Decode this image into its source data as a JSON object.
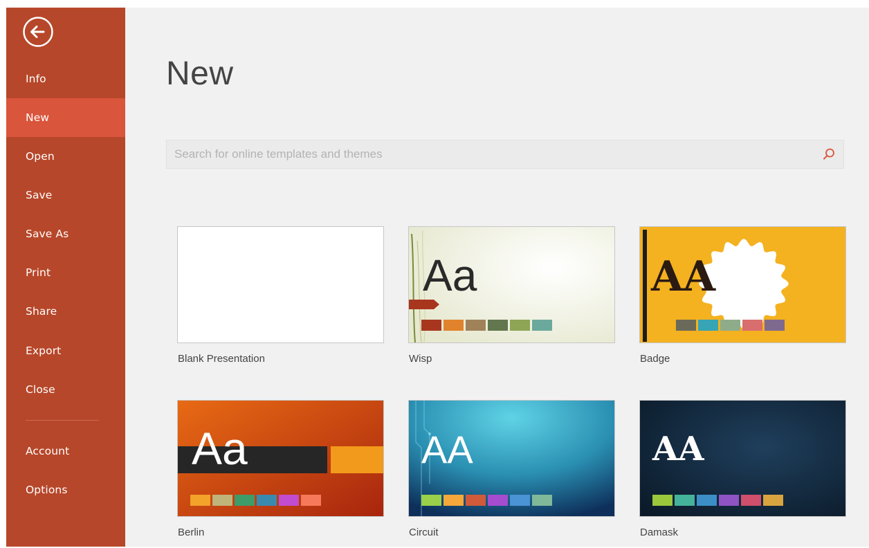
{
  "sidebar": {
    "back_icon": "back-arrow-icon",
    "items": [
      {
        "label": "Info"
      },
      {
        "label": "New",
        "selected": true
      },
      {
        "label": "Open"
      },
      {
        "label": "Save"
      },
      {
        "label": "Save As"
      },
      {
        "label": "Print"
      },
      {
        "label": "Share"
      },
      {
        "label": "Export"
      },
      {
        "label": "Close"
      },
      {
        "label": "Account"
      },
      {
        "label": "Options"
      }
    ]
  },
  "main": {
    "title": "New",
    "search": {
      "placeholder": "Search for online templates and themes",
      "icon": "search-icon"
    },
    "templates": [
      {
        "name": "Blank Presentation"
      },
      {
        "name": "Wisp",
        "thumb_text": "Aa",
        "swatches": [
          "#a8361f",
          "#e0832c",
          "#a0825a",
          "#62774d",
          "#8ea556",
          "#6aa99c"
        ]
      },
      {
        "name": "Badge",
        "thumb_text": "AA",
        "swatches": [
          "#6b6a5a",
          "#37a5b5",
          "#8fac8a",
          "#d96e6e",
          "#7f6a8f"
        ]
      },
      {
        "name": "Berlin",
        "thumb_text": "Aa",
        "swatches": [
          "#f3a22a",
          "#bfb47a",
          "#3e9b6a",
          "#3a8ab0",
          "#c24ccf",
          "#f7795c"
        ]
      },
      {
        "name": "Circuit",
        "thumb_text": "AA",
        "swatches": [
          "#9bd04a",
          "#f7a83a",
          "#d15a3a",
          "#a64ccf",
          "#4a93d4",
          "#7fb99a"
        ]
      },
      {
        "name": "Damask",
        "thumb_text": "AA",
        "swatches": [
          "#9bc73c",
          "#45b39b",
          "#3b8fc6",
          "#8f53c4",
          "#cf4f6c",
          "#d9a43f"
        ]
      }
    ]
  },
  "colors": {
    "sidebar_bg": "#b7472a",
    "sidebar_selected": "#d9553b",
    "main_bg": "#f1f1f1"
  }
}
